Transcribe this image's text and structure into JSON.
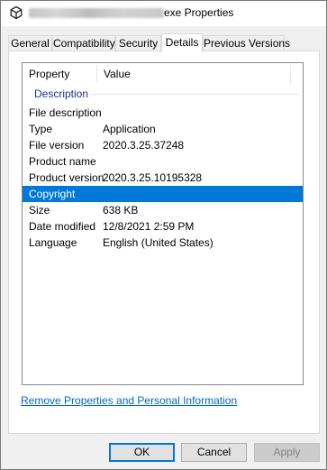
{
  "window": {
    "title_suffix": "exe Properties"
  },
  "tabs": [
    {
      "label": "General"
    },
    {
      "label": "Compatibility"
    },
    {
      "label": "Security"
    },
    {
      "label": "Details",
      "active": true
    },
    {
      "label": "Previous Versions"
    }
  ],
  "details": {
    "columns": {
      "property": "Property",
      "value": "Value"
    },
    "group_label": "Description",
    "rows": [
      {
        "property": "File description",
        "value": ""
      },
      {
        "property": "Type",
        "value": "Application"
      },
      {
        "property": "File version",
        "value": "2020.3.25.37248"
      },
      {
        "property": "Product name",
        "value": ""
      },
      {
        "property": "Product version",
        "value": "2020.3.25.10195328"
      },
      {
        "property": "Copyright",
        "value": "",
        "selected": true
      },
      {
        "property": "Size",
        "value": "638 KB"
      },
      {
        "property": "Date modified",
        "value": "12/8/2021 2:59 PM"
      },
      {
        "property": "Language",
        "value": "English (United States)"
      }
    ]
  },
  "links": {
    "remove_properties": "Remove Properties and Personal Information"
  },
  "buttons": {
    "ok": "OK",
    "cancel": "Cancel",
    "apply": "Apply",
    "apply_enabled": false
  },
  "colors": {
    "selection": "#0078d7",
    "group_header": "#1e3287",
    "link": "#0066cc"
  },
  "icons": {
    "app_icon": "unity-logo-icon"
  }
}
